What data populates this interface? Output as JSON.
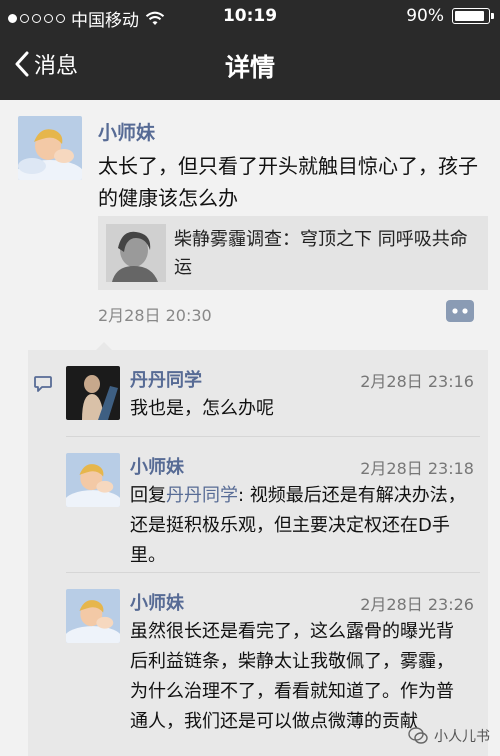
{
  "status_bar": {
    "carrier": "中国移动",
    "time": "10:19",
    "battery_percent": "90%",
    "battery_level": 0.9
  },
  "nav": {
    "back_label": "消息",
    "title": "详情"
  },
  "post": {
    "author": "小师妹",
    "text": "太长了，但只看了开头就触目惊心了，孩子的健康该怎么办",
    "link_title": "柴静雾霾调查：穹顶之下 同呼吸共命运",
    "time": "2月28日 20:30"
  },
  "comments": [
    {
      "author": "丹丹同学",
      "time": "2月28日 23:16",
      "text": "我也是，怎么办呢"
    },
    {
      "author": "小师妹",
      "time": "2月28日 23:18",
      "reply_prefix": "回复",
      "reply_to": "丹丹同学",
      "reply_sep": ": ",
      "text": "视频最后还是有解决办法，还是挺积极乐观，但主要决定权还在D手里。"
    },
    {
      "author": "小师妹",
      "time": "2月28日 23:26",
      "text": "虽然很长还是看完了，这么露骨的曝光背后利益链条，柴静太让我敬佩了，雾霾，为什么治理不了，看看就知道了。作为普通人，我们还是可以做点微薄的贡献"
    }
  ],
  "watermark": "小人儿书",
  "colors": {
    "bar_bg": "#2a2a2a",
    "name_link": "#576b95",
    "page_bg": "#f2f2f2",
    "comment_bg": "#e8e8e8"
  }
}
